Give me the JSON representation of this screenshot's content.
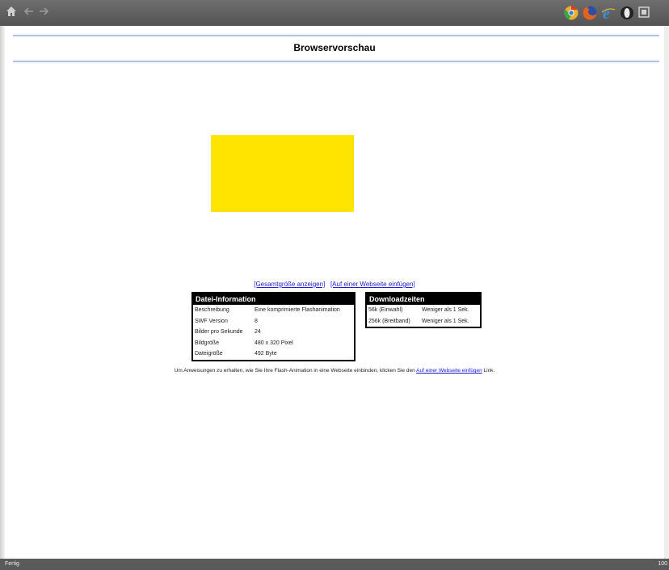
{
  "toolbar": {
    "icons": [
      "home-icon",
      "back-arrow-icon",
      "forward-arrow-icon"
    ],
    "browsers": [
      {
        "name": "chrome-icon",
        "color": "#e8b02c"
      },
      {
        "name": "firefox-icon",
        "color": "#e2621f"
      },
      {
        "name": "internet-explorer-icon",
        "color": "#3a8fd9"
      },
      {
        "name": "opera-icon",
        "color": "#222222"
      }
    ]
  },
  "page": {
    "title": "Browservorschau",
    "flash_color": "#ffe400"
  },
  "links": {
    "fullsize": "[Gesamtgröße anzeigen]",
    "embed": "[Auf einer Webseite einfügen]"
  },
  "file_info": {
    "header": "Datei-Information",
    "rows": [
      {
        "label": "Beschreibung",
        "value": "Eine komprimierte Flashanimation"
      },
      {
        "label": "SWF Version",
        "value": "8"
      },
      {
        "label": "Bilder pro Sekunde",
        "value": "24"
      },
      {
        "label": "Bildgröße",
        "value": "480 x 320 Pixel"
      },
      {
        "label": "Dateigröße",
        "value": "492 Byte"
      }
    ]
  },
  "download": {
    "header": "Downloadzeiten",
    "rows": [
      {
        "label": "56k (Einwahl)",
        "value": "Weniger als 1 Sek."
      },
      {
        "label": "256k (Breitband)",
        "value": "Weniger als 1 Sek."
      }
    ]
  },
  "note": {
    "before": "Um Anweisungen zu erhalten, wie Sie Ihre Flash-Animation in eine Webseite einbinden, klicken Sie den ",
    "link": "Auf einer Webseite einfügen",
    "after": " Link."
  },
  "status": {
    "left": "Fertig",
    "right": "100"
  }
}
